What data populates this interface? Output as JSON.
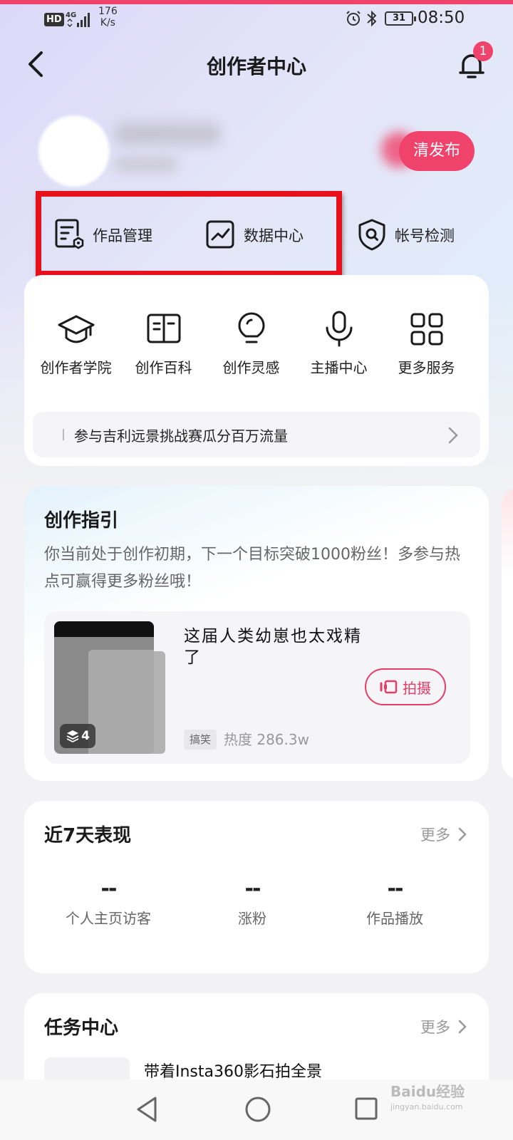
{
  "status_bar": {
    "hd": "HD",
    "network": "4G",
    "speed_value": "176",
    "speed_unit": "K/s",
    "battery": "31",
    "time": "08:50"
  },
  "header": {
    "title": "创作者中心",
    "notification_count": "1"
  },
  "profile": {
    "publish_label": "清发布"
  },
  "quick_actions": [
    {
      "label": "作品管理",
      "icon": "document-settings-icon"
    },
    {
      "label": "数据中心",
      "icon": "chart-line-icon"
    },
    {
      "label": "帐号检测",
      "icon": "shield-search-icon"
    }
  ],
  "services": [
    {
      "label": "创作者学院",
      "icon": "graduation-cap-icon"
    },
    {
      "label": "创作百科",
      "icon": "open-book-icon"
    },
    {
      "label": "创作灵感",
      "icon": "lightbulb-icon"
    },
    {
      "label": "主播中心",
      "icon": "microphone-icon"
    },
    {
      "label": "更多服务",
      "icon": "grid-icon"
    }
  ],
  "banner": {
    "text": "参与吉利远景挑战赛瓜分百万流量"
  },
  "guide": {
    "title": "创作指引",
    "description": "你当前处于创作初期，下一个目标突破1000粉丝！多参与热点可赢得更多粉丝哦！",
    "topic": {
      "title": "这届人类幼崽也太戏精了",
      "image_count": "4",
      "shoot_label": "拍摄",
      "tag": "搞笑",
      "heat": "热度 286.3w"
    }
  },
  "performance": {
    "title": "近7天表现",
    "more_label": "更多",
    "stats": [
      {
        "value": "--",
        "label": "个人主页访客"
      },
      {
        "value": "--",
        "label": "涨粉"
      },
      {
        "value": "--",
        "label": "作品播放"
      }
    ]
  },
  "tasks": {
    "title": "任务中心",
    "more_label": "更多",
    "first_task": "带着Insta360影石拍全景"
  },
  "watermark": {
    "brand": "Baidu经验",
    "url": "jingyan.baidu.com"
  },
  "colors": {
    "accent": "#f0436c",
    "highlight_box": "#e8111b",
    "shoot_button": "#e53d68"
  }
}
